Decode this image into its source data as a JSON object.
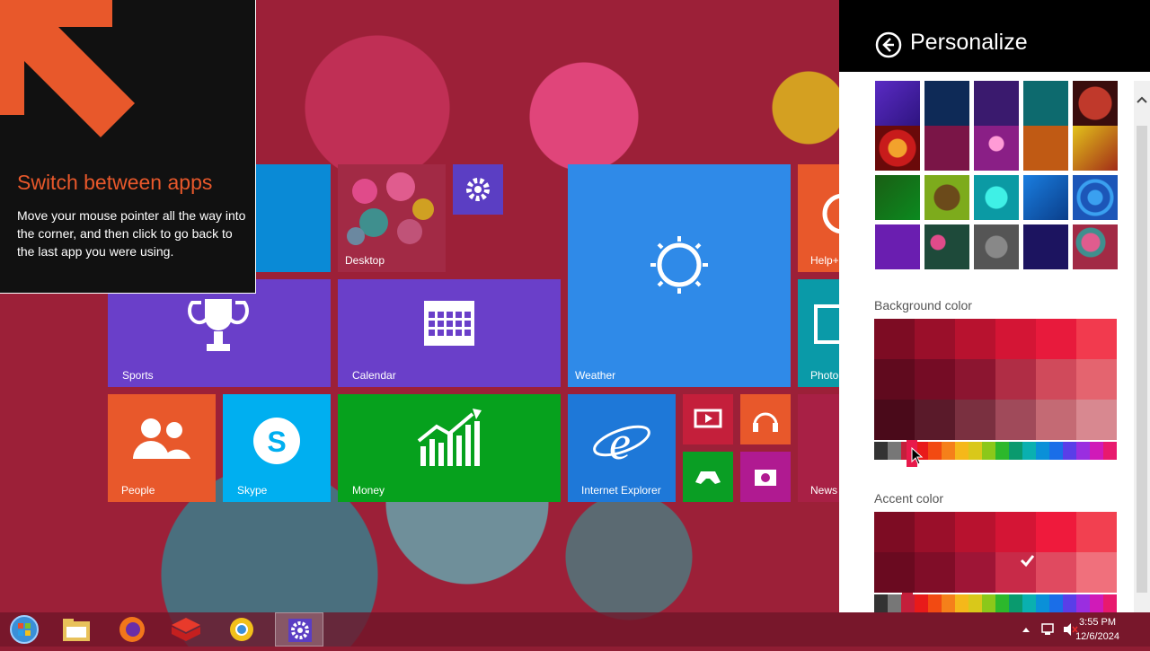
{
  "tooltip": {
    "title": "Switch between apps",
    "body": "Move your mouse pointer all the way into the corner, and then click to go back to the last app you were using."
  },
  "tiles": {
    "desktop": "Desktop",
    "sports": "Sports",
    "calendar": "Calendar",
    "weather": "Weather",
    "photos": "Photo",
    "help": "Help+",
    "people": "People",
    "skype": "Skype",
    "money": "Money",
    "ie": "Internet Explorer",
    "news": "News"
  },
  "panel": {
    "title": "Personalize",
    "background_color_label": "Background color",
    "accent_color_label": "Accent color"
  },
  "clock": {
    "time": "3:55 PM",
    "date": "12/6/2024"
  },
  "colors": {
    "accent": "#e81a4b",
    "tooltip_title": "#e8582b"
  }
}
